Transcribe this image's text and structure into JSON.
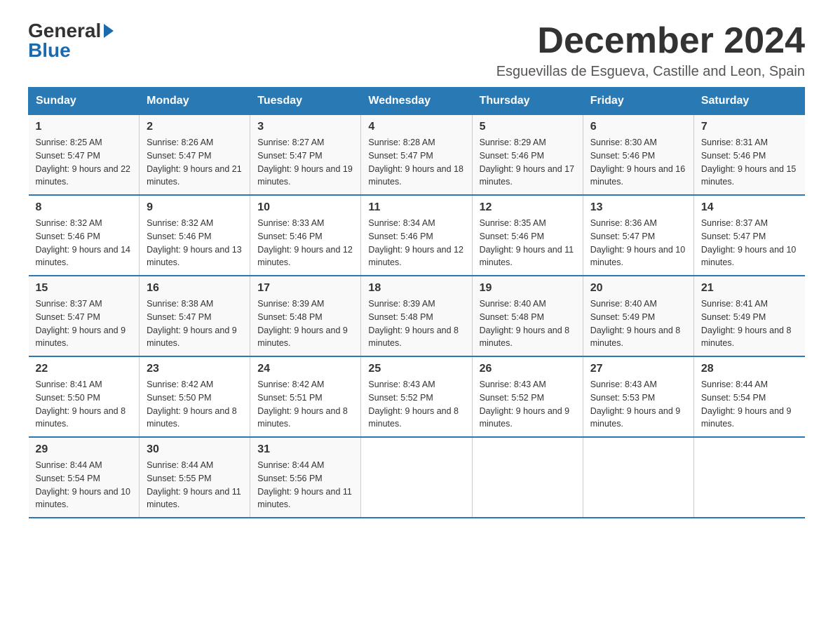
{
  "header": {
    "logo_general": "General",
    "logo_blue": "Blue",
    "month_title": "December 2024",
    "location": "Esguevillas de Esgueva, Castille and Leon, Spain"
  },
  "days_of_week": [
    "Sunday",
    "Monday",
    "Tuesday",
    "Wednesday",
    "Thursday",
    "Friday",
    "Saturday"
  ],
  "weeks": [
    [
      {
        "day": "1",
        "sunrise": "Sunrise: 8:25 AM",
        "sunset": "Sunset: 5:47 PM",
        "daylight": "Daylight: 9 hours and 22 minutes."
      },
      {
        "day": "2",
        "sunrise": "Sunrise: 8:26 AM",
        "sunset": "Sunset: 5:47 PM",
        "daylight": "Daylight: 9 hours and 21 minutes."
      },
      {
        "day": "3",
        "sunrise": "Sunrise: 8:27 AM",
        "sunset": "Sunset: 5:47 PM",
        "daylight": "Daylight: 9 hours and 19 minutes."
      },
      {
        "day": "4",
        "sunrise": "Sunrise: 8:28 AM",
        "sunset": "Sunset: 5:47 PM",
        "daylight": "Daylight: 9 hours and 18 minutes."
      },
      {
        "day": "5",
        "sunrise": "Sunrise: 8:29 AM",
        "sunset": "Sunset: 5:46 PM",
        "daylight": "Daylight: 9 hours and 17 minutes."
      },
      {
        "day": "6",
        "sunrise": "Sunrise: 8:30 AM",
        "sunset": "Sunset: 5:46 PM",
        "daylight": "Daylight: 9 hours and 16 minutes."
      },
      {
        "day": "7",
        "sunrise": "Sunrise: 8:31 AM",
        "sunset": "Sunset: 5:46 PM",
        "daylight": "Daylight: 9 hours and 15 minutes."
      }
    ],
    [
      {
        "day": "8",
        "sunrise": "Sunrise: 8:32 AM",
        "sunset": "Sunset: 5:46 PM",
        "daylight": "Daylight: 9 hours and 14 minutes."
      },
      {
        "day": "9",
        "sunrise": "Sunrise: 8:32 AM",
        "sunset": "Sunset: 5:46 PM",
        "daylight": "Daylight: 9 hours and 13 minutes."
      },
      {
        "day": "10",
        "sunrise": "Sunrise: 8:33 AM",
        "sunset": "Sunset: 5:46 PM",
        "daylight": "Daylight: 9 hours and 12 minutes."
      },
      {
        "day": "11",
        "sunrise": "Sunrise: 8:34 AM",
        "sunset": "Sunset: 5:46 PM",
        "daylight": "Daylight: 9 hours and 12 minutes."
      },
      {
        "day": "12",
        "sunrise": "Sunrise: 8:35 AM",
        "sunset": "Sunset: 5:46 PM",
        "daylight": "Daylight: 9 hours and 11 minutes."
      },
      {
        "day": "13",
        "sunrise": "Sunrise: 8:36 AM",
        "sunset": "Sunset: 5:47 PM",
        "daylight": "Daylight: 9 hours and 10 minutes."
      },
      {
        "day": "14",
        "sunrise": "Sunrise: 8:37 AM",
        "sunset": "Sunset: 5:47 PM",
        "daylight": "Daylight: 9 hours and 10 minutes."
      }
    ],
    [
      {
        "day": "15",
        "sunrise": "Sunrise: 8:37 AM",
        "sunset": "Sunset: 5:47 PM",
        "daylight": "Daylight: 9 hours and 9 minutes."
      },
      {
        "day": "16",
        "sunrise": "Sunrise: 8:38 AM",
        "sunset": "Sunset: 5:47 PM",
        "daylight": "Daylight: 9 hours and 9 minutes."
      },
      {
        "day": "17",
        "sunrise": "Sunrise: 8:39 AM",
        "sunset": "Sunset: 5:48 PM",
        "daylight": "Daylight: 9 hours and 9 minutes."
      },
      {
        "day": "18",
        "sunrise": "Sunrise: 8:39 AM",
        "sunset": "Sunset: 5:48 PM",
        "daylight": "Daylight: 9 hours and 8 minutes."
      },
      {
        "day": "19",
        "sunrise": "Sunrise: 8:40 AM",
        "sunset": "Sunset: 5:48 PM",
        "daylight": "Daylight: 9 hours and 8 minutes."
      },
      {
        "day": "20",
        "sunrise": "Sunrise: 8:40 AM",
        "sunset": "Sunset: 5:49 PM",
        "daylight": "Daylight: 9 hours and 8 minutes."
      },
      {
        "day": "21",
        "sunrise": "Sunrise: 8:41 AM",
        "sunset": "Sunset: 5:49 PM",
        "daylight": "Daylight: 9 hours and 8 minutes."
      }
    ],
    [
      {
        "day": "22",
        "sunrise": "Sunrise: 8:41 AM",
        "sunset": "Sunset: 5:50 PM",
        "daylight": "Daylight: 9 hours and 8 minutes."
      },
      {
        "day": "23",
        "sunrise": "Sunrise: 8:42 AM",
        "sunset": "Sunset: 5:50 PM",
        "daylight": "Daylight: 9 hours and 8 minutes."
      },
      {
        "day": "24",
        "sunrise": "Sunrise: 8:42 AM",
        "sunset": "Sunset: 5:51 PM",
        "daylight": "Daylight: 9 hours and 8 minutes."
      },
      {
        "day": "25",
        "sunrise": "Sunrise: 8:43 AM",
        "sunset": "Sunset: 5:52 PM",
        "daylight": "Daylight: 9 hours and 8 minutes."
      },
      {
        "day": "26",
        "sunrise": "Sunrise: 8:43 AM",
        "sunset": "Sunset: 5:52 PM",
        "daylight": "Daylight: 9 hours and 9 minutes."
      },
      {
        "day": "27",
        "sunrise": "Sunrise: 8:43 AM",
        "sunset": "Sunset: 5:53 PM",
        "daylight": "Daylight: 9 hours and 9 minutes."
      },
      {
        "day": "28",
        "sunrise": "Sunrise: 8:44 AM",
        "sunset": "Sunset: 5:54 PM",
        "daylight": "Daylight: 9 hours and 9 minutes."
      }
    ],
    [
      {
        "day": "29",
        "sunrise": "Sunrise: 8:44 AM",
        "sunset": "Sunset: 5:54 PM",
        "daylight": "Daylight: 9 hours and 10 minutes."
      },
      {
        "day": "30",
        "sunrise": "Sunrise: 8:44 AM",
        "sunset": "Sunset: 5:55 PM",
        "daylight": "Daylight: 9 hours and 11 minutes."
      },
      {
        "day": "31",
        "sunrise": "Sunrise: 8:44 AM",
        "sunset": "Sunset: 5:56 PM",
        "daylight": "Daylight: 9 hours and 11 minutes."
      },
      null,
      null,
      null,
      null
    ]
  ]
}
